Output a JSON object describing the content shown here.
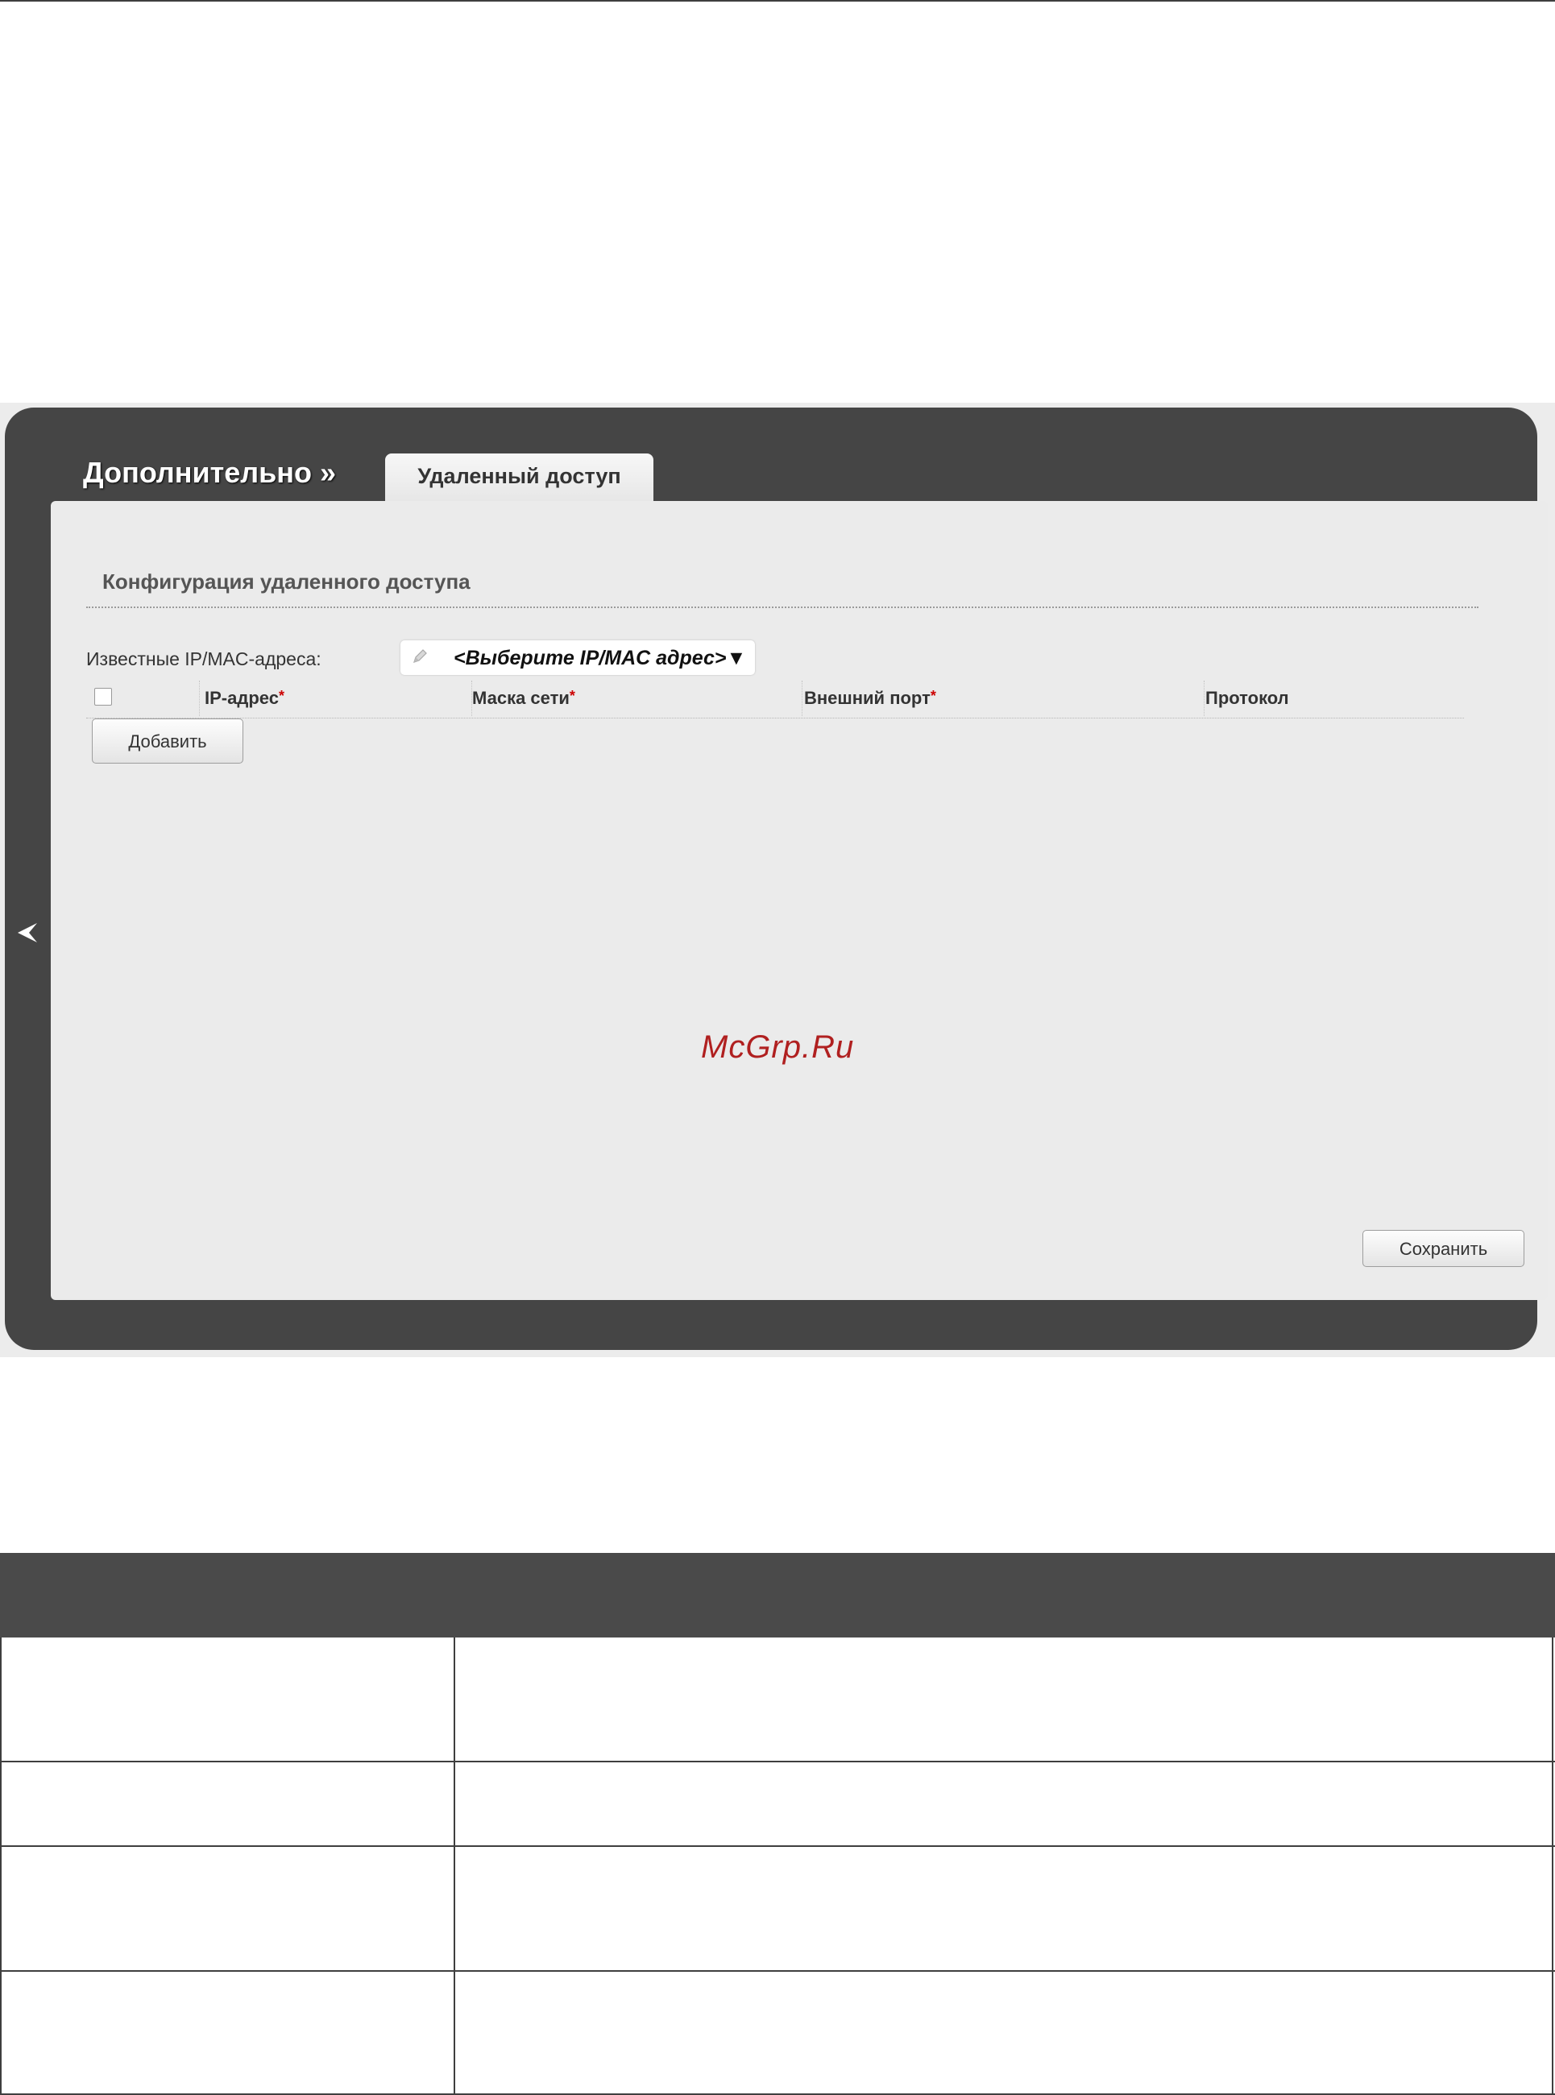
{
  "window": {
    "breadcrumb": "Дополнительно »",
    "tab_label": "Удаленный доступ"
  },
  "section": {
    "title": "Конфигурация удаленного доступа"
  },
  "known_addresses": {
    "label": "Известные IP/MAC-адреса:",
    "selected": "<Выберите IP/MAC адрес>▼"
  },
  "table": {
    "columns": [
      {
        "label": "IP-адрес",
        "required": "*"
      },
      {
        "label": "Маска сети",
        "required": "*"
      },
      {
        "label": "Внешний порт",
        "required": "*"
      },
      {
        "label": "Протокол",
        "required": ""
      }
    ]
  },
  "buttons": {
    "add": "Добавить",
    "save": "Сохранить"
  },
  "watermark": "McGrp.Ru",
  "icons": {
    "pencil": "pencil-icon",
    "back": "chevron-left-icon"
  },
  "colors": {
    "panel": "#454545",
    "content": "#ebebeb",
    "required": "#cc0000",
    "watermark": "#b02020"
  }
}
